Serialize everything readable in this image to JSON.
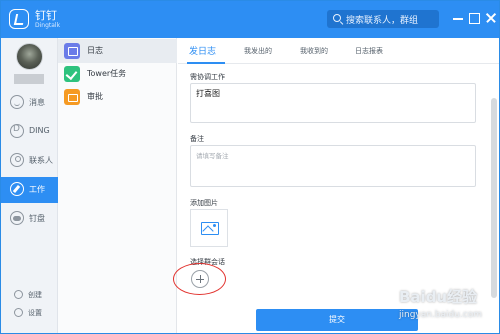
{
  "app": {
    "name": "钉钉",
    "subtitle": "Dingtalk",
    "brand_color": "#2d8ef3"
  },
  "search": {
    "placeholder": "搜索联系人，群组",
    "icon": "search-icon"
  },
  "window_controls": [
    "minimize-icon",
    "maximize-icon",
    "close-icon"
  ],
  "leftnav": {
    "items": [
      {
        "label": "消息",
        "icon": "message-icon",
        "active": false
      },
      {
        "label": "DING",
        "icon": "ding-icon",
        "active": false
      },
      {
        "label": "联系人",
        "icon": "contacts-icon",
        "active": false
      },
      {
        "label": "工作",
        "icon": "work-icon",
        "active": true
      },
      {
        "label": "钉盘",
        "icon": "disk-icon",
        "active": false
      }
    ],
    "bottom": [
      {
        "label": "创建",
        "icon": "create-icon"
      },
      {
        "label": "设置",
        "icon": "settings-icon"
      }
    ]
  },
  "apps": [
    {
      "label": "日志",
      "icon": "log-icon",
      "selected": true
    },
    {
      "label": "Tower任务",
      "icon": "tower-icon",
      "selected": false
    },
    {
      "label": "审批",
      "icon": "approval-icon",
      "selected": false
    }
  ],
  "tabs": [
    {
      "label": "发日志",
      "active": true
    },
    {
      "label": "我发出的",
      "active": false
    },
    {
      "label": "我收到的",
      "active": false
    },
    {
      "label": "日志报表",
      "active": false
    }
  ],
  "form": {
    "coordination_label": "需协调工作",
    "coordination_value": "打喜图",
    "notes_label": "备注",
    "notes_placeholder": "请填写备注",
    "photo_label": "添加图片",
    "group_label": "选择群会话",
    "submit_label": "提交"
  },
  "watermark": {
    "main": "Baidu经验",
    "sub": "jingyan.baidu.com"
  }
}
